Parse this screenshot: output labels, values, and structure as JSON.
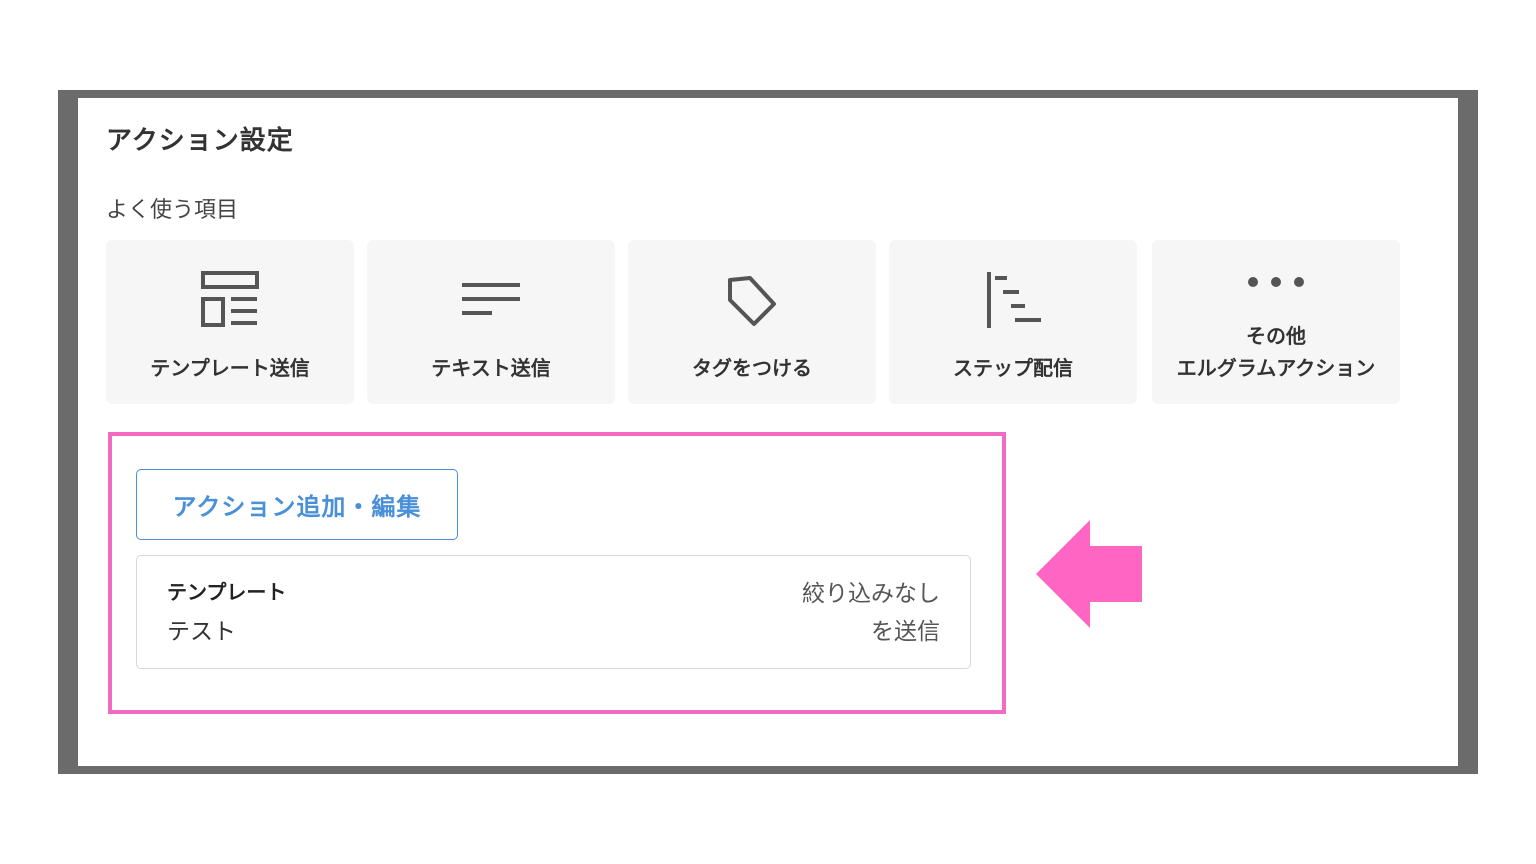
{
  "header": {
    "title": "アクション設定",
    "subtitle": "よく使う項目"
  },
  "tiles": [
    {
      "label": "テンプレート送信",
      "icon": "template-icon"
    },
    {
      "label": "テキスト送信",
      "icon": "text-lines-icon"
    },
    {
      "label": "タグをつける",
      "icon": "tag-icon"
    },
    {
      "label": "ステップ配信",
      "icon": "step-icon"
    },
    {
      "label_line1": "その他",
      "label_line2": "エルグラムアクション",
      "icon": "more-dots-icon"
    }
  ],
  "edit_button": {
    "label": "アクション追加・編集"
  },
  "action_item": {
    "type": "テンプレート",
    "name": "テスト",
    "filter": "絞り込みなし",
    "send": "を送信"
  },
  "colors": {
    "frame": "#6b6b6b",
    "tile_bg": "#f6f6f6",
    "accent_blue": "#4a90d9",
    "highlight_pink": "#f36ac2",
    "arrow_pink": "#ff66c4"
  }
}
